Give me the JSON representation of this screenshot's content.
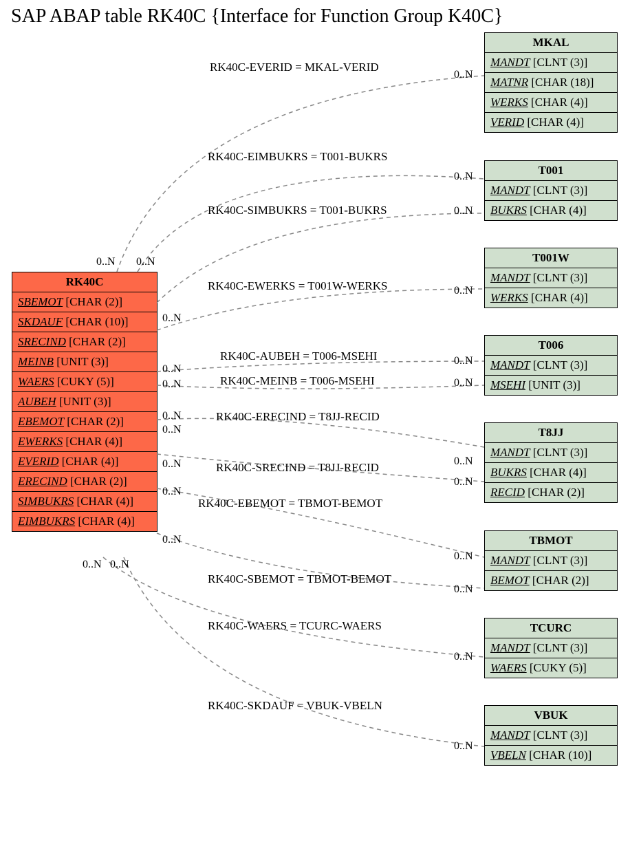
{
  "title": "SAP ABAP table RK40C {Interface for Function Group  K40C}",
  "source": {
    "name": "RK40C",
    "fields": [
      {
        "f": "SBEMOT",
        "t": "[CHAR (2)]"
      },
      {
        "f": "SKDAUF",
        "t": "[CHAR (10)]"
      },
      {
        "f": "SRECIND",
        "t": "[CHAR (2)]"
      },
      {
        "f": "MEINB",
        "t": "[UNIT (3)]"
      },
      {
        "f": "WAERS",
        "t": "[CUKY (5)]"
      },
      {
        "f": "AUBEH",
        "t": "[UNIT (3)]"
      },
      {
        "f": "EBEMOT",
        "t": "[CHAR (2)]"
      },
      {
        "f": "EWERKS",
        "t": "[CHAR (4)]"
      },
      {
        "f": "EVERID",
        "t": "[CHAR (4)]"
      },
      {
        "f": "ERECIND",
        "t": "[CHAR (2)]"
      },
      {
        "f": "SIMBUKRS",
        "t": "[CHAR (4)]"
      },
      {
        "f": "EIMBUKRS",
        "t": "[CHAR (4)]"
      }
    ]
  },
  "targets": [
    {
      "name": "MKAL",
      "fields": [
        {
          "f": "MANDT",
          "t": "[CLNT (3)]"
        },
        {
          "f": "MATNR",
          "t": "[CHAR (18)]"
        },
        {
          "f": "WERKS",
          "t": "[CHAR (4)]"
        },
        {
          "f": "VERID",
          "t": "[CHAR (4)]"
        }
      ]
    },
    {
      "name": "T001",
      "fields": [
        {
          "f": "MANDT",
          "t": "[CLNT (3)]"
        },
        {
          "f": "BUKRS",
          "t": "[CHAR (4)]"
        }
      ]
    },
    {
      "name": "T001W",
      "fields": [
        {
          "f": "MANDT",
          "t": "[CLNT (3)]"
        },
        {
          "f": "WERKS",
          "t": "[CHAR (4)]"
        }
      ]
    },
    {
      "name": "T006",
      "fields": [
        {
          "f": "MANDT",
          "t": "[CLNT (3)]"
        },
        {
          "f": "MSEHI",
          "t": "[UNIT (3)]"
        }
      ]
    },
    {
      "name": "T8JJ",
      "fields": [
        {
          "f": "MANDT",
          "t": "[CLNT (3)]"
        },
        {
          "f": "BUKRS",
          "t": "[CHAR (4)]"
        },
        {
          "f": "RECID",
          "t": "[CHAR (2)]"
        }
      ]
    },
    {
      "name": "TBMOT",
      "fields": [
        {
          "f": "MANDT",
          "t": "[CLNT (3)]"
        },
        {
          "f": "BEMOT",
          "t": "[CHAR (2)]"
        }
      ]
    },
    {
      "name": "TCURC",
      "fields": [
        {
          "f": "MANDT",
          "t": "[CLNT (3)]"
        },
        {
          "f": "WAERS",
          "t": "[CUKY (5)]"
        }
      ]
    },
    {
      "name": "VBUK",
      "fields": [
        {
          "f": "MANDT",
          "t": "[CLNT (3)]"
        },
        {
          "f": "VBELN",
          "t": "[CHAR (10)]"
        }
      ]
    }
  ],
  "edges": [
    {
      "label": "RK40C-EVERID = MKAL-VERID"
    },
    {
      "label": "RK40C-EIMBUKRS = T001-BUKRS"
    },
    {
      "label": "RK40C-SIMBUKRS = T001-BUKRS"
    },
    {
      "label": "RK40C-EWERKS = T001W-WERKS"
    },
    {
      "label": "RK40C-AUBEH = T006-MSEHI"
    },
    {
      "label": "RK40C-MEINB = T006-MSEHI"
    },
    {
      "label": "RK40C-ERECIND = T8JJ-RECID"
    },
    {
      "label": "RK40C-SRECIND = T8JJ-RECID"
    },
    {
      "label": "RK40C-EBEMOT = TBMOT-BEMOT"
    },
    {
      "label": "RK40C-SBEMOT = TBMOT-BEMOT"
    },
    {
      "label": "RK40C-WAERS = TCURC-WAERS"
    },
    {
      "label": "RK40C-SKDAUF = VBUK-VBELN"
    }
  ],
  "cardinality": "0..N"
}
